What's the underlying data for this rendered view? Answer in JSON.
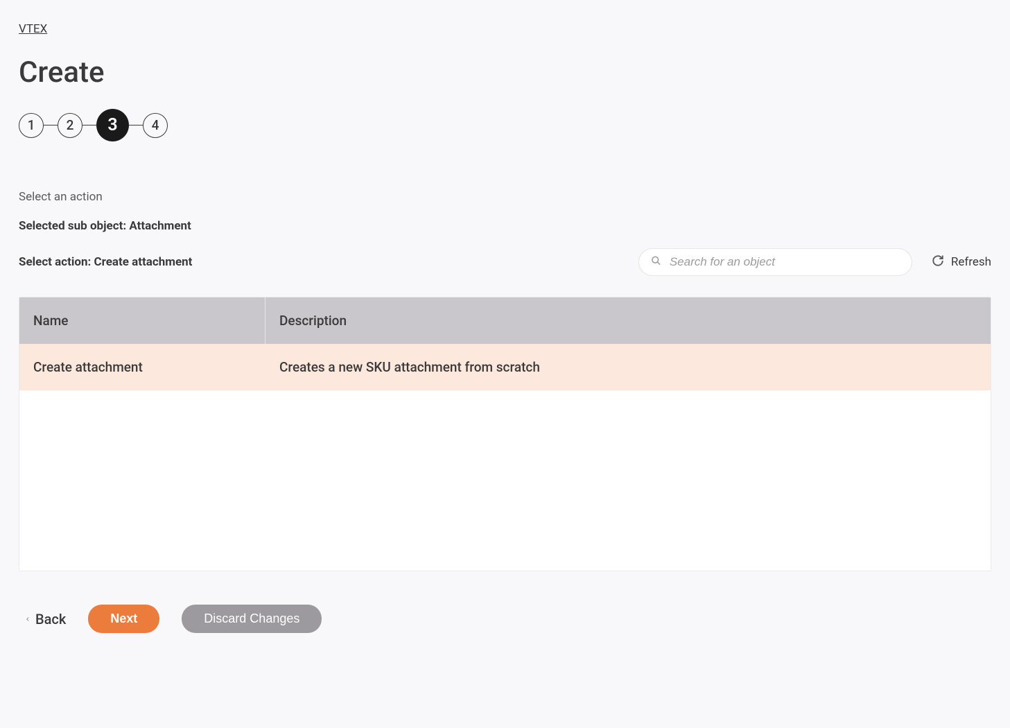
{
  "breadcrumb": {
    "label": "VTEX"
  },
  "page": {
    "title": "Create"
  },
  "stepper": {
    "steps": [
      "1",
      "2",
      "3",
      "4"
    ],
    "activeIndex": 2
  },
  "section": {
    "label": "Select an action",
    "selectedSubObject": "Selected sub object: Attachment",
    "selectedAction": "Select action: Create attachment"
  },
  "search": {
    "placeholder": "Search for an object"
  },
  "refresh": {
    "label": "Refresh"
  },
  "table": {
    "headers": {
      "name": "Name",
      "description": "Description"
    },
    "rows": [
      {
        "name": "Create attachment",
        "description": "Creates a new SKU attachment from scratch"
      }
    ]
  },
  "footer": {
    "back": "Back",
    "next": "Next",
    "discard": "Discard Changes"
  }
}
